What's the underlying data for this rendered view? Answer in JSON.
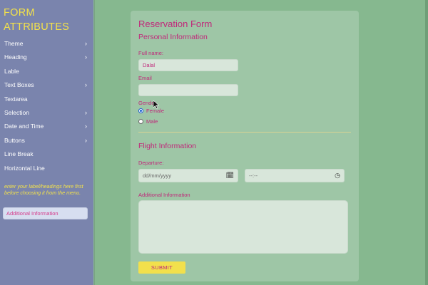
{
  "sidebar": {
    "title_line1": "FORM",
    "title_line2": "ATTRIBUTES",
    "items": [
      {
        "label": "Theme",
        "chevron": "›"
      },
      {
        "label": "Heading",
        "chevron": "›"
      },
      {
        "label": "Lable",
        "chevron": ""
      },
      {
        "label": "Text Boxes",
        "chevron": "›"
      },
      {
        "label": "Textarea",
        "chevron": ""
      },
      {
        "label": "Selection",
        "chevron": "›"
      },
      {
        "label": "Date and Time",
        "chevron": "›"
      },
      {
        "label": "Buttons",
        "chevron": "›"
      },
      {
        "label": "Line Break",
        "chevron": ""
      },
      {
        "label": "Horizontal Line",
        "chevron": ""
      }
    ],
    "hint": "enter your label/headings here first before choosing it from the menu.",
    "label_input_value": "Additional Information"
  },
  "form": {
    "title": "Reservation Form",
    "personal_section": "Personal Information",
    "fullname_label": "Full name:",
    "fullname_value": "Dalal",
    "email_label": "Email",
    "email_value": "",
    "gender_label": "Gender",
    "gender_options": [
      "Female",
      "Male"
    ],
    "gender_selected": "Female",
    "flight_section": "Flight Information",
    "departure_label": "Departure:",
    "date_placeholder": "dd/mm/yyyy",
    "time_placeholder": "--:--",
    "additional_label": "Additional Information",
    "submit_label": "SUBMIT"
  },
  "colors": {
    "sidebar_bg": "#7a84ad",
    "accent_yellow": "#f4e24a",
    "page_bg": "#86b88f",
    "card_bg": "#9ec6a6",
    "text_pink": "#c0287a",
    "radio_blue": "#1a5fd0"
  },
  "icons": {
    "chevron": "chevron-right-icon",
    "calendar": "calendar-icon",
    "clock": "clock-icon",
    "cursor": "mouse-cursor-icon"
  }
}
